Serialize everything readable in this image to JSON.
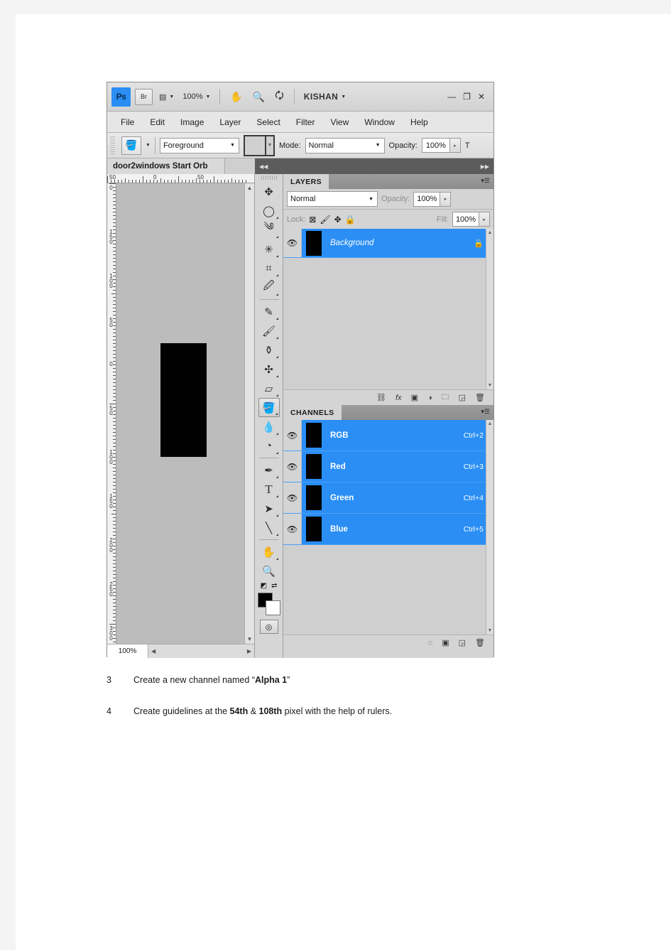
{
  "app": {
    "logo": "Ps",
    "bridge_button": "Br",
    "zoom_level": "100%",
    "username": "KISHAN",
    "window_controls": {
      "minimize": "—",
      "maximize": "❐",
      "close": "✕"
    },
    "icons": {
      "arrange": "view-arrange-icon",
      "hand": "hand-icon",
      "zoom": "zoom-icon",
      "rotate": "rotate-view-icon",
      "caret": "chevron-down-icon"
    }
  },
  "menubar": [
    "File",
    "Edit",
    "Image",
    "Layer",
    "Select",
    "Filter",
    "View",
    "Window",
    "Help"
  ],
  "options_bar": {
    "tool_icon": "paint-bucket-icon",
    "fill_source": "Foreground",
    "mode_label": "Mode:",
    "mode_value": "Normal",
    "opacity_label": "Opacity:",
    "opacity_value": "100%",
    "tolerance_label_clipped": "T"
  },
  "document": {
    "tab_title": "door2windows Start Orb",
    "zoom_status": "100%",
    "ruler_h": [
      "50",
      "0",
      "50"
    ],
    "ruler_v": [
      "0",
      "150",
      "100",
      "50",
      "0",
      "50",
      "100",
      "150",
      "200",
      "250",
      "300"
    ]
  },
  "tools": [
    {
      "name": "move-tool",
      "glyph": "✥"
    },
    {
      "name": "marquee-tool",
      "glyph": "◯"
    },
    {
      "name": "lasso-tool",
      "glyph": "༄"
    },
    {
      "name": "magic-wand-tool",
      "glyph": "✳"
    },
    {
      "name": "crop-tool",
      "glyph": "⌗"
    },
    {
      "name": "eyedropper-tool",
      "glyph": "🖉"
    },
    {
      "name": "healing-brush-tool",
      "glyph": "✎"
    },
    {
      "name": "brush-tool",
      "glyph": "🖌"
    },
    {
      "name": "clone-stamp-tool",
      "glyph": "⚱"
    },
    {
      "name": "history-brush-tool",
      "glyph": "✣"
    },
    {
      "name": "eraser-tool",
      "glyph": "▱"
    },
    {
      "name": "paint-bucket-tool",
      "glyph": "🪣"
    },
    {
      "name": "blur-tool",
      "glyph": "💧"
    },
    {
      "name": "dodge-tool",
      "glyph": "◔"
    },
    {
      "name": "pen-tool",
      "glyph": "✒"
    },
    {
      "name": "type-tool",
      "glyph": "T"
    },
    {
      "name": "path-selection-tool",
      "glyph": "➤"
    },
    {
      "name": "line-tool",
      "glyph": "╲"
    },
    {
      "name": "hand-tool",
      "glyph": "✋"
    },
    {
      "name": "zoom-tool",
      "glyph": "🔍"
    }
  ],
  "layers_panel": {
    "tab_label": "LAYERS",
    "blend_mode": "Normal",
    "opacity_label": "Opacity:",
    "opacity_value": "100%",
    "lock_label": "Lock:",
    "fill_label": "Fill:",
    "fill_value": "100%",
    "rows": [
      {
        "name": "Background",
        "locked": true
      }
    ],
    "footer_icons": [
      "link-icon",
      "fx-icon",
      "layer-mask-icon",
      "adjustment-layer-icon",
      "group-folder-icon",
      "new-layer-icon",
      "delete-layer-icon"
    ]
  },
  "channels_panel": {
    "tab_label": "CHANNELS",
    "rows": [
      {
        "name": "RGB",
        "shortcut": "Ctrl+2"
      },
      {
        "name": "Red",
        "shortcut": "Ctrl+3"
      },
      {
        "name": "Green",
        "shortcut": "Ctrl+4"
      },
      {
        "name": "Blue",
        "shortcut": "Ctrl+5"
      }
    ],
    "footer_icons": [
      "load-selection-icon",
      "save-selection-icon",
      "new-channel-icon",
      "delete-channel-icon"
    ]
  },
  "instructions": [
    {
      "num": "3",
      "html": "Create a new channel named  &#8220;<b>Alpha 1</b>&#8221;"
    },
    {
      "num": "4",
      "html": "Create guidelines at the  <b>54th</b> &amp; <b>108th</b> pixel with the help of rulers."
    }
  ],
  "colors": {
    "selection_blue": "#2a8ef5",
    "canvas_gray": "#bcbcbc",
    "shape_black": "#000000",
    "panel_gray": "#d4d4d4"
  }
}
